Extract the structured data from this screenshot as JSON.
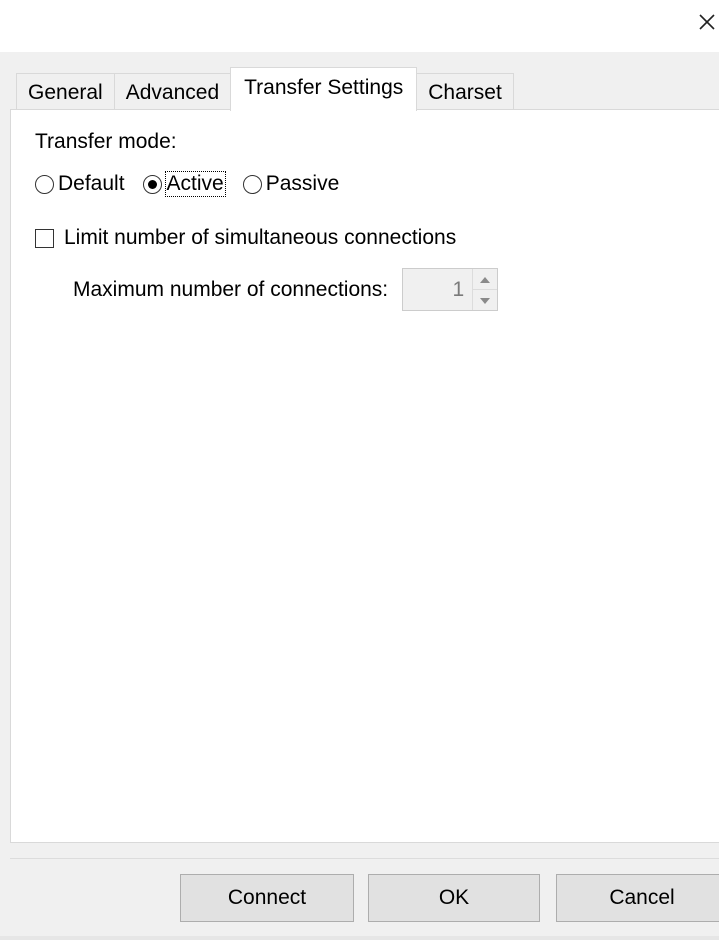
{
  "window": {
    "close_glyph": "✕"
  },
  "tabs": [
    {
      "label": "General",
      "active": false
    },
    {
      "label": "Advanced",
      "active": false
    },
    {
      "label": "Transfer Settings",
      "active": true
    },
    {
      "label": "Charset",
      "active": false
    }
  ],
  "transfer": {
    "mode_label": "Transfer mode:",
    "modes": [
      {
        "label": "Default",
        "selected": false
      },
      {
        "label": "Active",
        "selected": true
      },
      {
        "label": "Passive",
        "selected": false
      }
    ],
    "limit_label": "Limit number of simultaneous connections",
    "limit_checked": false,
    "max_label": "Maximum number of connections:",
    "max_value": "1"
  },
  "buttons": {
    "connect": "Connect",
    "ok": "OK",
    "cancel": "Cancel"
  },
  "colors": {
    "dialog_bg": "#f0f0f0",
    "panel_bg": "#ffffff",
    "button_bg": "#e1e1e1",
    "disabled_text": "#7a7a7a"
  }
}
